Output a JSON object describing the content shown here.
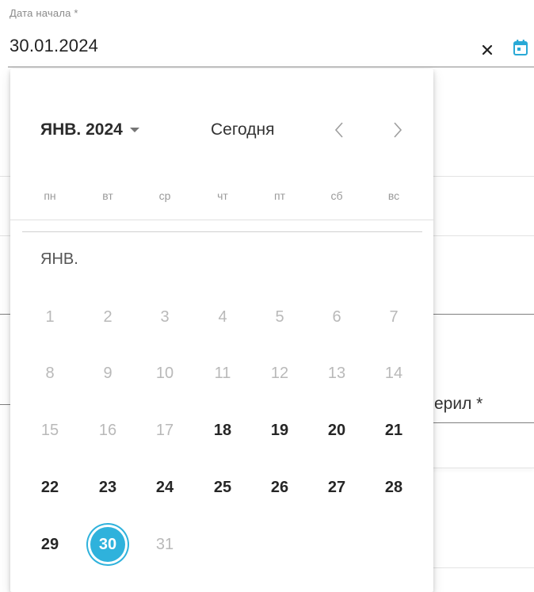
{
  "field": {
    "label": "Дата начала *",
    "value": "30.01.2024",
    "clear_icon": "close-icon",
    "calendar_icon": "calendar-icon"
  },
  "background": {
    "partial_label": "ерил *"
  },
  "calendar": {
    "month_year": "ЯНВ. 2024",
    "today_label": "Сегодня",
    "month_label": "ЯНВ.",
    "weekdays": [
      "пн",
      "вт",
      "ср",
      "чт",
      "пт",
      "сб",
      "вс"
    ],
    "weeks": [
      [
        "1",
        "2",
        "3",
        "4",
        "5",
        "6",
        "7"
      ],
      [
        "8",
        "9",
        "10",
        "11",
        "12",
        "13",
        "14"
      ],
      [
        "15",
        "16",
        "17",
        "18",
        "19",
        "20",
        "21"
      ],
      [
        "22",
        "23",
        "24",
        "25",
        "26",
        "27",
        "28"
      ],
      [
        "29",
        "30",
        "31"
      ]
    ],
    "disabled_days": [
      "1",
      "2",
      "3",
      "4",
      "5",
      "6",
      "7",
      "8",
      "9",
      "10",
      "11",
      "12",
      "13",
      "14",
      "15",
      "16",
      "17",
      "31"
    ],
    "selected_day": "30",
    "colors": {
      "accent": "#2fb2dc",
      "calendar_icon": "#29a9d6",
      "disabled": "#b9b9b9"
    }
  }
}
